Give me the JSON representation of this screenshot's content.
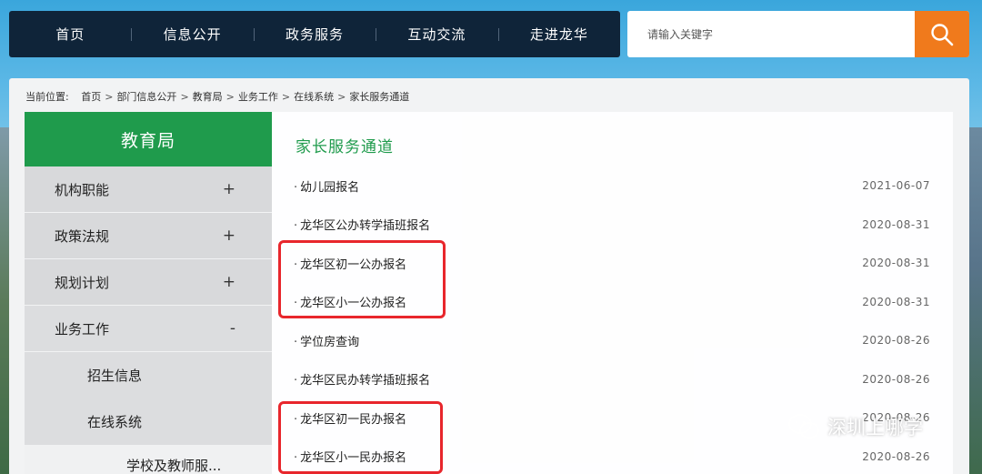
{
  "nav": {
    "items": [
      "首页",
      "信息公开",
      "政务服务",
      "互动交流",
      "走进龙华"
    ]
  },
  "search": {
    "placeholder": "请输入关键字",
    "icon": "search-icon"
  },
  "breadcrumb": {
    "prefix": "当前位置:",
    "items": [
      "首页",
      "部门信息公开",
      "教育局",
      "业务工作",
      "在线系统",
      "家长服务通道"
    ],
    "separator": ">"
  },
  "sidebar": {
    "title": "教育局",
    "items": [
      {
        "label": "机构职能",
        "toggle": "+"
      },
      {
        "label": "政策法规",
        "toggle": "+"
      },
      {
        "label": "规划计划",
        "toggle": "+"
      },
      {
        "label": "业务工作",
        "toggle": "-"
      }
    ],
    "subitems": [
      "招生信息",
      "在线系统"
    ],
    "subsubitems": [
      "学校及教师服..."
    ]
  },
  "content": {
    "title": "家长服务通道",
    "rows": [
      {
        "title": "幼儿园报名",
        "date": "2021-06-07"
      },
      {
        "title": "龙华区公办转学插班报名",
        "date": "2020-08-31"
      },
      {
        "title": "龙华区初一公办报名",
        "date": "2020-08-31"
      },
      {
        "title": "龙华区小一公办报名",
        "date": "2020-08-31"
      },
      {
        "title": "学位房查询",
        "date": "2020-08-26"
      },
      {
        "title": "龙华区民办转学插班报名",
        "date": "2020-08-26"
      },
      {
        "title": "龙华区初一民办报名",
        "date": "2020-08-26"
      },
      {
        "title": "龙华区小一民办报名",
        "date": "2020-08-26"
      }
    ]
  },
  "watermark": {
    "text": "深圳上哪学",
    "icon": "wechat-icon"
  },
  "colors": {
    "nav_bg": "#0f2439",
    "accent_green": "#1f9b4c",
    "search_orange": "#f07a1c",
    "highlight_red": "#e8262c"
  }
}
